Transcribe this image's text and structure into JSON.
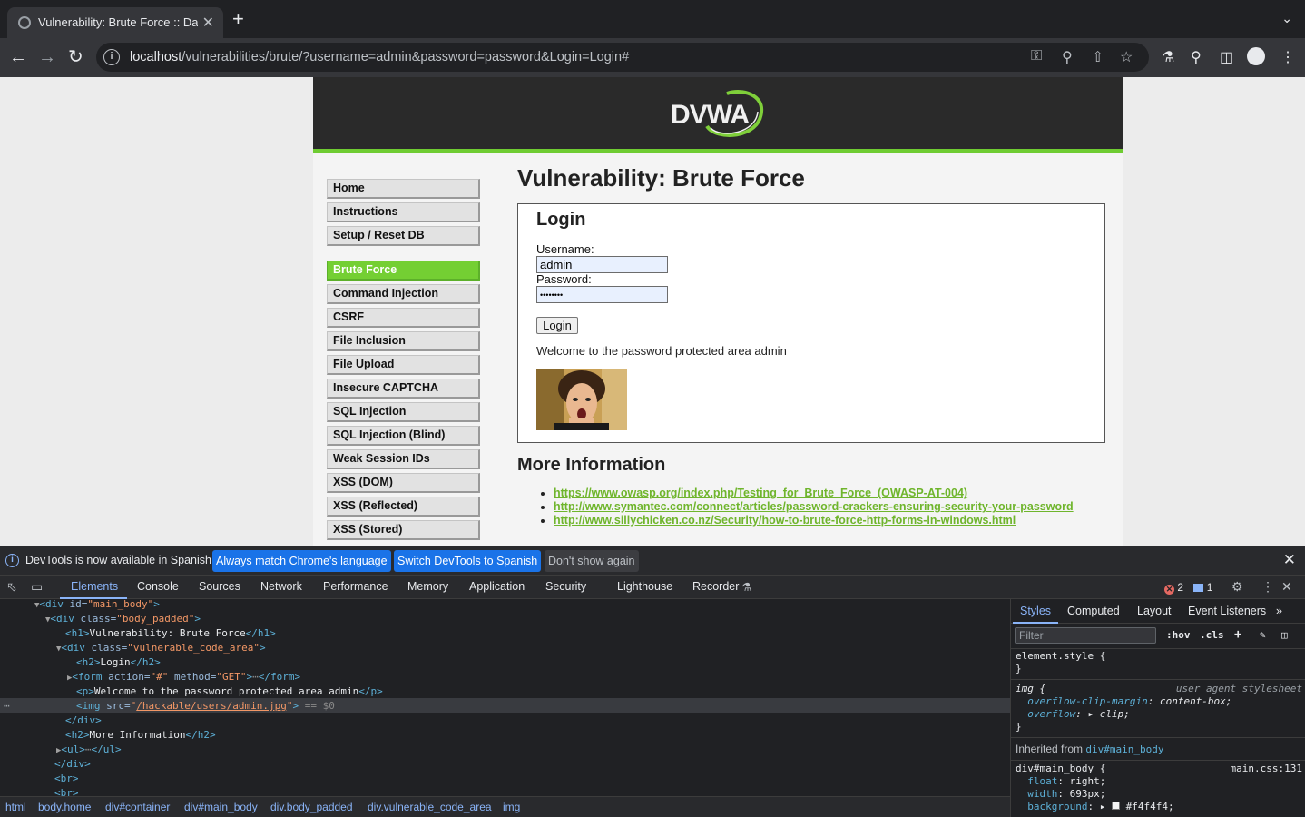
{
  "browser": {
    "tab_title": "Vulnerability: Brute Force :: Da",
    "tab_close": "✕",
    "new_tab": "+",
    "url_host": "localhost",
    "url_path": "/vulnerabilities/brute/?username=admin&password=password&Login=Login#"
  },
  "dvwa": {
    "logo_text": "DVWA",
    "menu_top": [
      "Home",
      "Instructions",
      "Setup / Reset DB"
    ],
    "menu_vulns": [
      "Brute Force",
      "Command Injection",
      "CSRF",
      "File Inclusion",
      "File Upload",
      "Insecure CAPTCHA",
      "SQL Injection",
      "SQL Injection (Blind)",
      "Weak Session IDs",
      "XSS (DOM)",
      "XSS (Reflected)",
      "XSS (Stored)"
    ],
    "active_item": "Brute Force",
    "page_title": "Vulnerability: Brute Force",
    "login_heading": "Login",
    "username_label": "Username:",
    "username_value": "admin",
    "password_label": "Password:",
    "password_value": "••••••••",
    "login_button": "Login",
    "welcome_text": "Welcome to the password protected area admin",
    "more_info_heading": "More Information",
    "links": [
      "https://www.owasp.org/index.php/Testing_for_Brute_Force_(OWASP-AT-004)",
      "http://www.symantec.com/connect/articles/password-crackers-ensuring-security-your-password",
      "http://www.sillychicken.co.nz/Security/how-to-brute-force-http-forms-in-windows.html"
    ],
    "accent_color": "#6fcc32"
  },
  "infobar": {
    "message": "DevTools is now available in Spanish!",
    "btn_match": "Always match Chrome's language",
    "btn_switch": "Switch DevTools to Spanish",
    "btn_dismiss": "Don't show again"
  },
  "devtools": {
    "tabs": [
      "Elements",
      "Console",
      "Sources",
      "Network",
      "Performance",
      "Memory",
      "Application",
      "Security",
      "Lighthouse",
      "Recorder"
    ],
    "error_count": "2",
    "message_count": "1",
    "dom": {
      "l1_tag": "<div",
      "l1_attr": " id=",
      "l1_val": "\"main_body\"",
      "l2_attr": " class=",
      "l2_val": "\"body_padded\"",
      "l3_text": "Vulnerability: Brute Force",
      "l4_val": "\"vulnerable_code_area\"",
      "l5_text": "Login",
      "l6_action": "\"#\"",
      "l6_method": "\"GET\"",
      "l7_text": "Welcome to the password protected area admin",
      "l8_src": "/hackable/users/admin.jpg",
      "l8_eq": " == $0",
      "l10_text": "More Information"
    },
    "breadcrumbs": [
      "html",
      "body.home",
      "div#container",
      "div#main_body",
      "div.body_padded",
      "div.vulnerable_code_area",
      "img"
    ],
    "styles_tabs": [
      "Styles",
      "Computed",
      "Layout",
      "Event Listeners"
    ],
    "filter_placeholder": "Filter",
    "hov": ":hov",
    "cls": ".cls",
    "element_style": "element.style {",
    "img_selector": "img {",
    "ua_label": "user agent stylesheet",
    "prop1": "overflow-clip-margin",
    "val1": "content-box;",
    "prop2": "overflow",
    "val2": "clip;",
    "inherited_label": "Inherited from",
    "inherited_from": "div#main_body",
    "main_selector": "div#main_body {",
    "main_source": "main.css:131",
    "prop3": "float",
    "val3": "right;",
    "prop4": "width",
    "val4": "693px;",
    "prop5": "background",
    "val5": "#f4f4f4;"
  }
}
